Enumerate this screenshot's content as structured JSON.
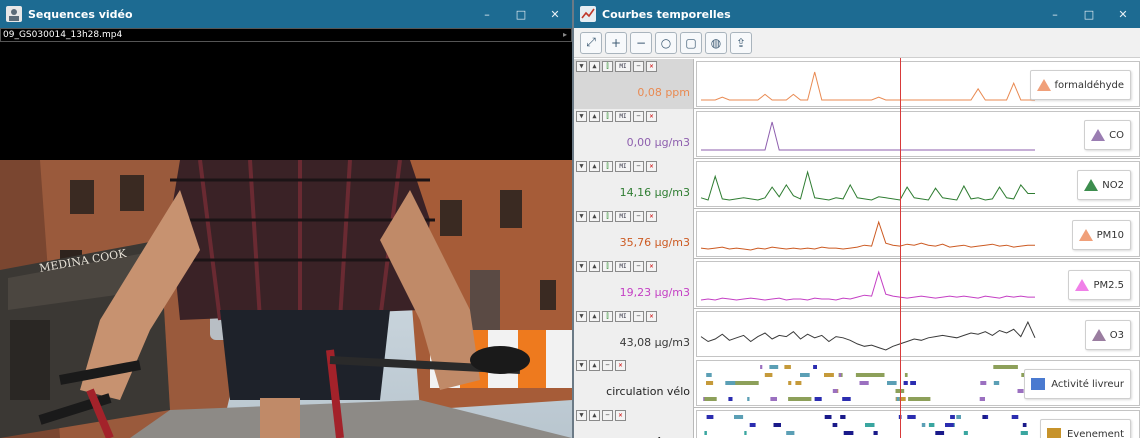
{
  "video_window": {
    "title": "Sequences vidéo",
    "controls": [
      "–",
      "□",
      "✕"
    ],
    "filename": "09_GS030014_13h28.mp4",
    "scene_text": {
      "storefront": "MEDINA COOK"
    }
  },
  "chart_window": {
    "title": "Courbes temporelles",
    "controls": [
      "–",
      "□",
      "✕"
    ],
    "toolbar": [
      {
        "icon": "zoom-fit-icon",
        "glyph": "⤢"
      },
      {
        "icon": "zoom-in-icon",
        "glyph": "+"
      },
      {
        "icon": "zoom-out-icon",
        "glyph": "−"
      },
      {
        "icon": "zoom-reset-icon",
        "glyph": "○"
      },
      {
        "icon": "screenshot-icon",
        "glyph": "▢"
      },
      {
        "icon": "comment-icon",
        "glyph": "◍"
      },
      {
        "icon": "export-icon",
        "glyph": "⇪"
      }
    ],
    "row_controls": {
      "down": "▼",
      "up": "▲",
      "marker": "⫿",
      "mi": "MI",
      "minimize": "−",
      "close": "✕"
    },
    "rows": [
      {
        "value": "0,08 ppm",
        "label": "formaldéhyde",
        "color": "#e98a52",
        "legend_color": "#f0a07a",
        "type": "line",
        "selected": true
      },
      {
        "value": "0,00 µg/m3",
        "label": "CO",
        "color": "#8e5fae",
        "legend_color": "#9a7db2",
        "type": "line",
        "selected": false
      },
      {
        "value": "14,16 µg/m3",
        "label": "NO2",
        "color": "#2f7d32",
        "legend_color": "#3d8d4e",
        "type": "line",
        "selected": false
      },
      {
        "value": "35,76 µg/m3",
        "label": "PM10",
        "color": "#cc5a22",
        "legend_color": "#f0a07a",
        "type": "line",
        "selected": false
      },
      {
        "value": "19,23 µg/m3",
        "label": "PM2.5",
        "color": "#c43fc4",
        "legend_color": "#f080e8",
        "type": "line",
        "selected": false
      },
      {
        "value": "43,08 µg/m3",
        "label": "O3",
        "color": "#3a3a3a",
        "legend_color": "#9a7da0",
        "type": "line",
        "selected": false
      },
      {
        "value": "circulation vélo",
        "label": "Activité livreur",
        "color": "#3a3a3a",
        "legend_color": "#4a7ad0",
        "type": "event",
        "selected": false
      },
      {
        "value": "Aucun",
        "label": "Evenement",
        "color": "#3a3a3a",
        "legend_color": "#c7932b",
        "type": "event",
        "selected": false
      }
    ]
  },
  "chart_data": [
    {
      "type": "line",
      "series": [
        {
          "name": "formaldéhyde",
          "values": [
            0.0,
            0.0,
            0.0,
            0.01,
            0.0,
            0.0,
            0.0,
            0.0,
            0.0,
            0.02,
            0.0,
            0.0,
            0.0,
            0.02,
            0.0,
            0.0,
            0.1,
            0.0,
            0.0,
            0.0,
            0.0,
            0.0,
            0.0,
            0.0,
            0.0,
            0.01,
            0.0,
            0.0,
            0.0,
            0.0,
            0.0,
            0.0,
            0.0,
            0.0,
            0.0,
            0.0,
            0.0,
            0.0,
            0.0,
            0.04,
            0.0,
            0.0,
            0.0,
            0.0,
            0.06,
            0.0,
            0.0,
            0.0
          ]
        }
      ]
    },
    {
      "type": "line",
      "series": [
        {
          "name": "CO",
          "values": [
            0.0,
            0.0,
            0.0,
            0.0,
            0.0,
            0.0,
            0.0,
            0.0,
            0.0,
            0.0,
            0.01,
            0.0,
            0.0,
            0.0,
            0.0,
            0.0,
            0.0,
            0.0,
            0.0,
            0.0,
            0.0,
            0.0,
            0.0,
            0.0,
            0.0,
            0.0,
            0.0,
            0.0,
            0.0,
            0.0,
            0.0,
            0.0,
            0.0,
            0.0,
            0.0,
            0.0,
            0.0,
            0.0,
            0.0,
            0.0,
            0.0,
            0.0,
            0.0,
            0.0,
            0.0,
            0.0,
            0.0,
            0.0
          ]
        }
      ]
    },
    {
      "type": "line",
      "series": [
        {
          "name": "NO2",
          "values": [
            10,
            8,
            30,
            9,
            8,
            9,
            10,
            9,
            8,
            10,
            20,
            11,
            22,
            12,
            9,
            34,
            10,
            9,
            8,
            10,
            9,
            22,
            10,
            9,
            8,
            11,
            10,
            9,
            8,
            20,
            10,
            9,
            8,
            19,
            10,
            9,
            8,
            21,
            9,
            10,
            8,
            9,
            20,
            10,
            9,
            22,
            14,
            14
          ]
        }
      ]
    },
    {
      "type": "line",
      "series": [
        {
          "name": "PM10",
          "values": [
            33,
            32,
            33,
            34,
            32,
            33,
            32,
            31,
            33,
            32,
            34,
            33,
            32,
            33,
            32,
            33,
            32,
            34,
            33,
            33,
            32,
            33,
            34,
            36,
            35,
            60,
            38,
            36,
            35,
            37,
            36,
            38,
            36,
            35,
            37,
            34,
            35,
            36,
            34,
            35,
            36,
            37,
            35,
            36,
            34,
            35,
            36,
            36
          ]
        }
      ]
    },
    {
      "type": "line",
      "series": [
        {
          "name": "PM2.5",
          "values": [
            16,
            17,
            16,
            18,
            17,
            16,
            17,
            18,
            17,
            16,
            17,
            18,
            16,
            17,
            17,
            16,
            18,
            17,
            17,
            16,
            18,
            17,
            19,
            21,
            20,
            45,
            22,
            20,
            19,
            18,
            19,
            20,
            19,
            18,
            19,
            20,
            19,
            20,
            19,
            18,
            20,
            19,
            18,
            20,
            19,
            20,
            19,
            19
          ]
        }
      ]
    },
    {
      "type": "line",
      "series": [
        {
          "name": "O3",
          "values": [
            44,
            40,
            42,
            46,
            41,
            43,
            45,
            40,
            44,
            47,
            42,
            45,
            44,
            48,
            42,
            46,
            43,
            45,
            40,
            44,
            43,
            41,
            38,
            36,
            37,
            35,
            33,
            36,
            38,
            40,
            42,
            41,
            43,
            44,
            45,
            44,
            43,
            45,
            47,
            46,
            48,
            45,
            49,
            47,
            50,
            44,
            56,
            43
          ]
        }
      ]
    },
    {
      "type": "event",
      "series": [
        {
          "name": "Activité livreur",
          "values": []
        }
      ]
    },
    {
      "type": "event",
      "series": [
        {
          "name": "Evenement",
          "values": []
        }
      ]
    }
  ]
}
